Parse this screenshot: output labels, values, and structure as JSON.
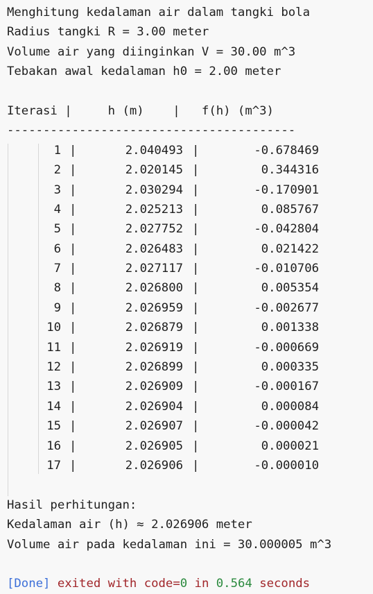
{
  "intro": {
    "line1": "Menghitung kedalaman air dalam tangki bola",
    "line2": "Radius tangki R = 3.00 meter",
    "line3": "Volume air yang diinginkan V = 30.00 m^3",
    "line4": "Tebakan awal kedalaman h0 = 2.00 meter"
  },
  "table": {
    "header": "Iterasi |     h (m)    |   f(h) (m^3)",
    "divider": "----------------------------------------",
    "separator": "|",
    "rows": [
      {
        "iter": "1",
        "h": "2.040493",
        "f": "-0.678469"
      },
      {
        "iter": "2",
        "h": "2.020145",
        "f": "0.344316"
      },
      {
        "iter": "3",
        "h": "2.030294",
        "f": "-0.170901"
      },
      {
        "iter": "4",
        "h": "2.025213",
        "f": "0.085767"
      },
      {
        "iter": "5",
        "h": "2.027752",
        "f": "-0.042804"
      },
      {
        "iter": "6",
        "h": "2.026483",
        "f": "0.021422"
      },
      {
        "iter": "7",
        "h": "2.027117",
        "f": "-0.010706"
      },
      {
        "iter": "8",
        "h": "2.026800",
        "f": "0.005354"
      },
      {
        "iter": "9",
        "h": "2.026959",
        "f": "-0.002677"
      },
      {
        "iter": "10",
        "h": "2.026879",
        "f": "0.001338"
      },
      {
        "iter": "11",
        "h": "2.026919",
        "f": "-0.000669"
      },
      {
        "iter": "12",
        "h": "2.026899",
        "f": "0.000335"
      },
      {
        "iter": "13",
        "h": "2.026909",
        "f": "-0.000167"
      },
      {
        "iter": "14",
        "h": "2.026904",
        "f": "0.000084"
      },
      {
        "iter": "15",
        "h": "2.026907",
        "f": "-0.000042"
      },
      {
        "iter": "16",
        "h": "2.026905",
        "f": "0.000021"
      },
      {
        "iter": "17",
        "h": "2.026906",
        "f": "-0.000010"
      }
    ]
  },
  "result": {
    "title": "Hasil perhitungan:",
    "depth": "Kedalaman air (h) ≈ 2.026906 meter",
    "volume": "Volume air pada kedalaman ini = 30.000005 m^3"
  },
  "done": {
    "tag": "[Done]",
    "exited": " exited with ",
    "code": "code=",
    "code_value": "0",
    "in": " in ",
    "time": "0.564",
    "seconds": " seconds"
  },
  "colors": {
    "background": "#f8f8f8",
    "text": "#1f1f1f",
    "done_tag": "#3c6fd8",
    "done_keyword": "#a1262a",
    "done_number": "#2b8a3e"
  }
}
